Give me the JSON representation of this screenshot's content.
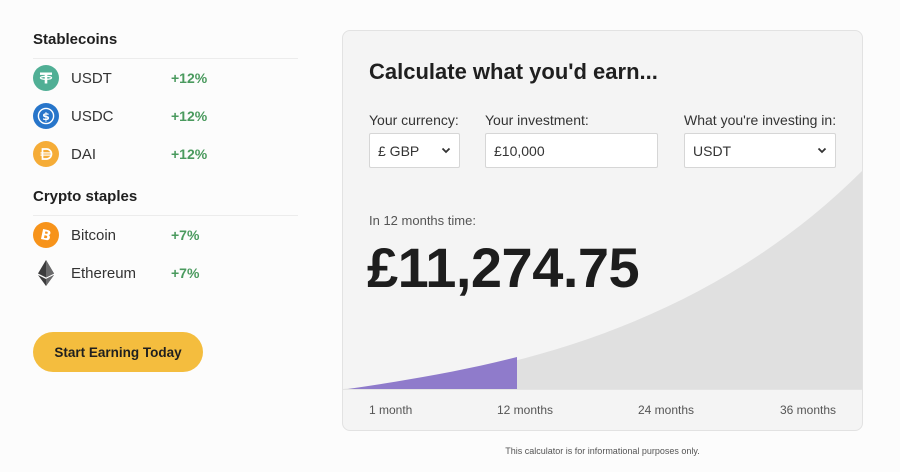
{
  "stablecoins": {
    "title": "Stablecoins",
    "items": [
      {
        "name": "USDT",
        "rate": "+12%",
        "icon": "tether-icon",
        "color": "#50af95"
      },
      {
        "name": "USDC",
        "rate": "+12%",
        "icon": "usdc-icon",
        "color": "#2775ca"
      },
      {
        "name": "DAI",
        "rate": "+12%",
        "icon": "dai-icon",
        "color": "#f5ac37"
      }
    ]
  },
  "staples": {
    "title": "Crypto staples",
    "items": [
      {
        "name": "Bitcoin",
        "rate": "+7%",
        "icon": "bitcoin-icon",
        "color": "#f7931a"
      },
      {
        "name": "Ethereum",
        "rate": "+7%",
        "icon": "ethereum-icon",
        "color": "#3c3c3d"
      }
    ]
  },
  "cta_label": "Start Earning Today",
  "calculator": {
    "title": "Calculate what you'd earn...",
    "currency_label": "Your currency:",
    "currency_value": "£ GBP",
    "investment_label": "Your investment:",
    "investment_value": "£10,000",
    "asset_label": "What you're investing in:",
    "asset_value": "USDT",
    "timeframe": "In 12 months time:",
    "result": "£11,274.75",
    "ticks": [
      "1 month",
      "12 months",
      "24 months",
      "36 months"
    ],
    "selected_months": 12,
    "max_months": 36
  },
  "disclaimer": "This calculator is for informational purposes only.",
  "colors": {
    "accent": "#f4bd3e",
    "positive": "#4a9a5e",
    "growth_highlight": "#8f7bcb",
    "growth_area": "#e0e0e0"
  }
}
